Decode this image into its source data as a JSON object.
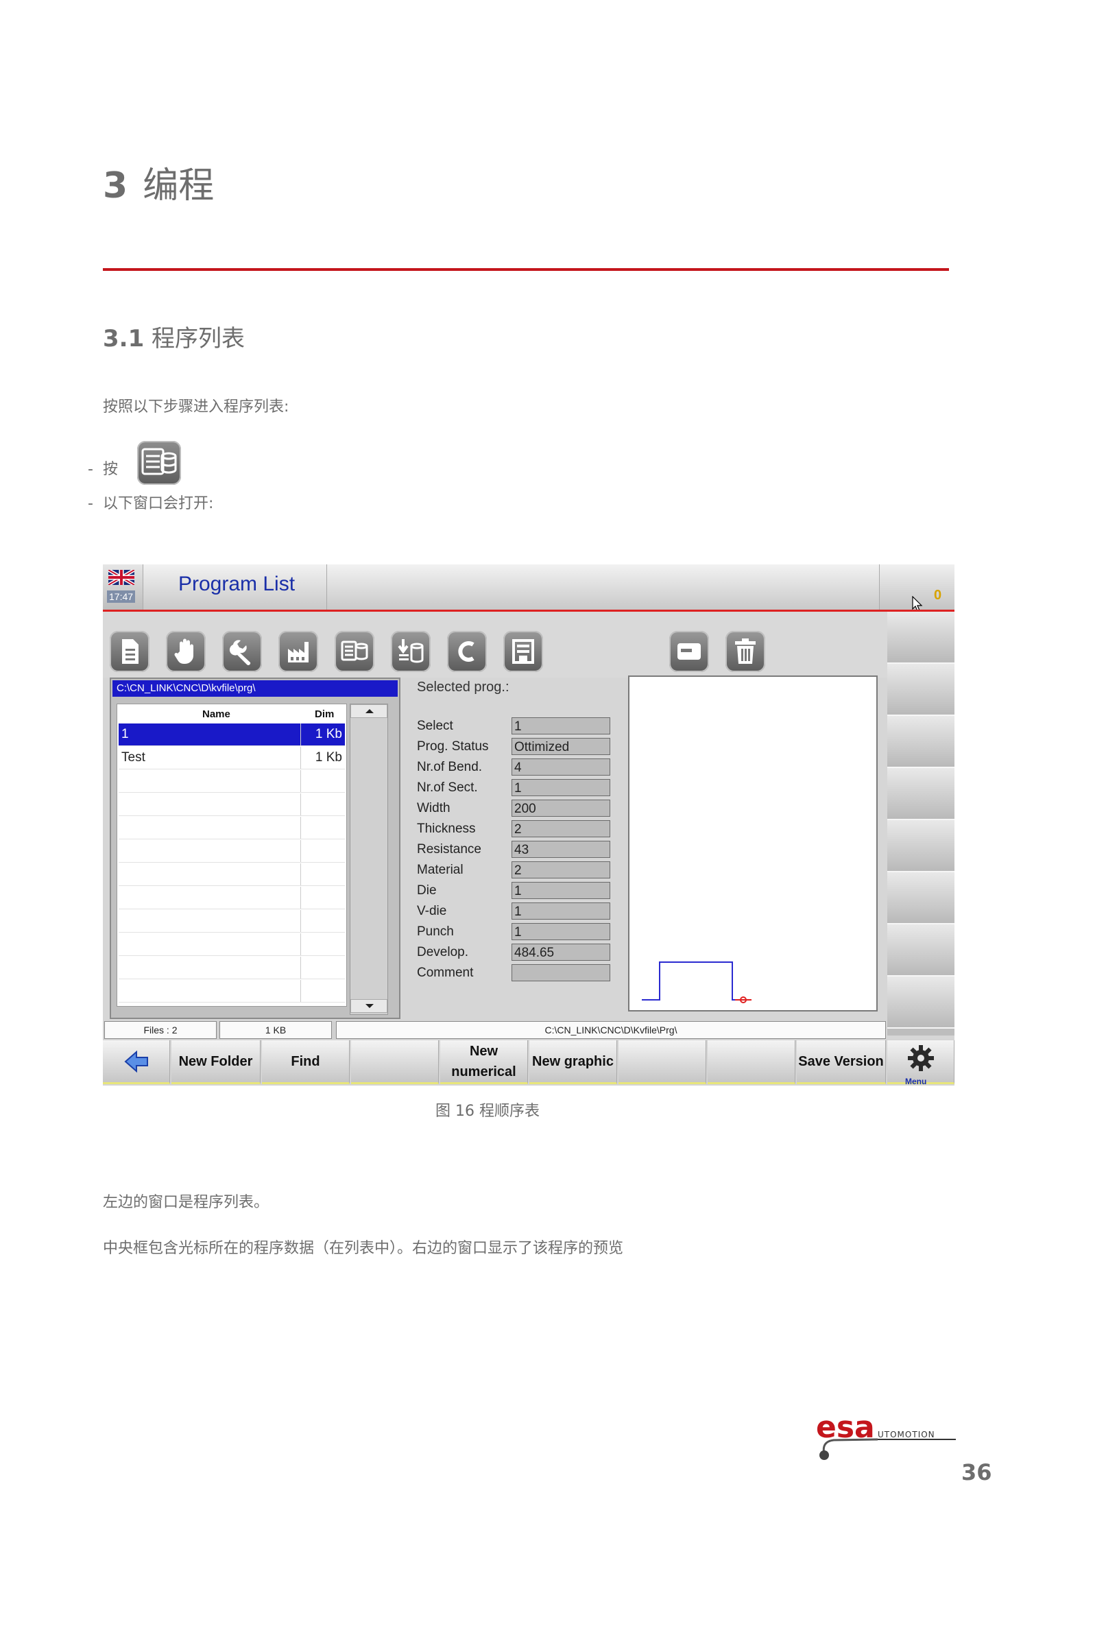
{
  "heading": {
    "number": "3",
    "title": "编程"
  },
  "section": {
    "number": "3.1",
    "title": "程序列表"
  },
  "intro": "按照以下步骤进入程序列表:",
  "steps": [
    {
      "bullet": "-",
      "text": "按"
    },
    {
      "bullet": "-",
      "text": "以下窗口会打开:"
    }
  ],
  "screen": {
    "clock": "17:47",
    "title": "Program List",
    "counter": "0",
    "path": "C:\\CN_LINK\\CNC\\D\\kvfile\\prg\\",
    "columns": {
      "name": "Name",
      "dim": "Dim"
    },
    "rows": [
      {
        "name": "1",
        "dim": "1 Kb",
        "selected": true
      },
      {
        "name": "Test",
        "dim": "1 Kb",
        "selected": false
      }
    ],
    "selected_header": "Selected prog.:",
    "fields": [
      {
        "label": "Select",
        "value": "1"
      },
      {
        "label": "Prog. Status",
        "value": "Ottimized"
      },
      {
        "label": "Nr.of Bend.",
        "value": "4"
      },
      {
        "label": "Nr.of Sect.",
        "value": "1"
      },
      {
        "label": "Width",
        "value": "200"
      },
      {
        "label": "Thickness",
        "value": "2"
      },
      {
        "label": "Resistance",
        "value": "43"
      },
      {
        "label": "Material",
        "value": "2"
      },
      {
        "label": "Die",
        "value": "1"
      },
      {
        "label": "V-die",
        "value": "1"
      },
      {
        "label": "Punch",
        "value": "1"
      },
      {
        "label": "Develop.",
        "value": "484.65"
      },
      {
        "label": "Comment",
        "value": ""
      }
    ],
    "status": {
      "files": "Files : 2",
      "size": "1 KB",
      "path": "C:\\CN_LINK\\CNC\\D\\Kvfile\\Prg\\"
    },
    "function_keys": {
      "new_folder": "New Folder",
      "find": "Find",
      "new_numerical_1": "New",
      "new_numerical_2": "numerical",
      "new_graphic": "New graphic",
      "save_version": "Save Version",
      "menu": "Menu"
    }
  },
  "caption": "图 16  程顺序表",
  "para1": "左边的窗口是程序列表。",
  "para2": "中央框包含光标所在的程序数据（在列表中）。右边的窗口显示了该程序的预览",
  "page_number": "36",
  "colors": {
    "accent_red": "#c4161c",
    "title_blue": "#1a2fa8",
    "selection_blue": "#1919c8"
  }
}
